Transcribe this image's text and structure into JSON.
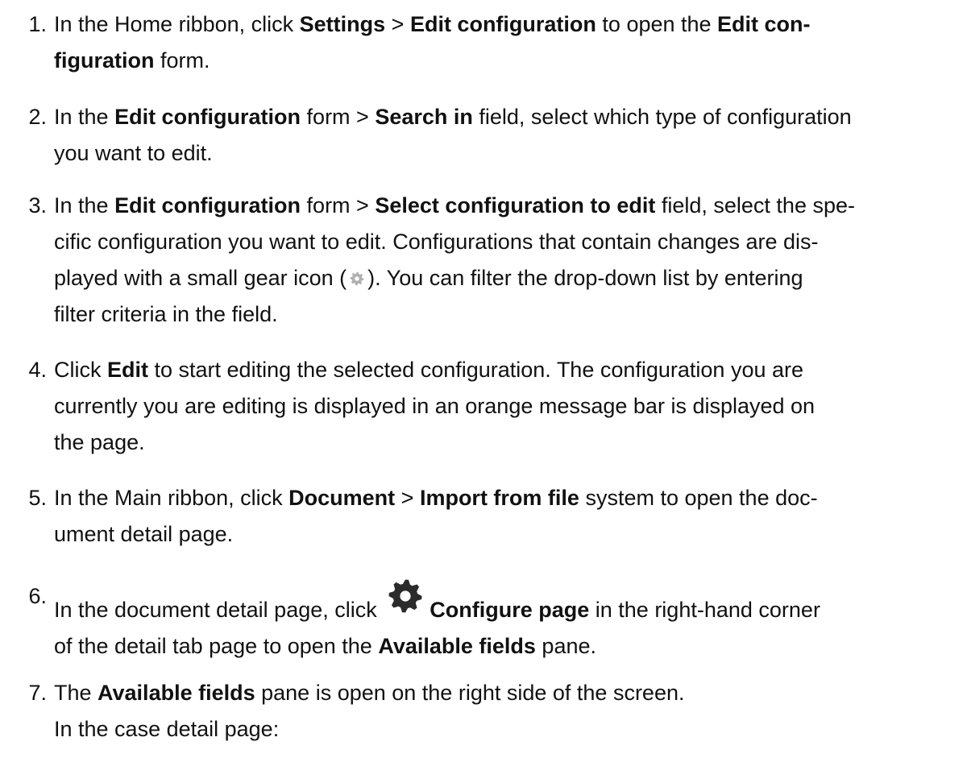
{
  "steps": [
    {
      "number": "1.",
      "lines": [
        [
          {
            "t": "In the Home ribbon, click "
          },
          {
            "t": "Settings",
            "b": true
          },
          {
            "t": " > "
          },
          {
            "t": "Edit configuration",
            "b": true
          },
          {
            "t": " to open the "
          },
          {
            "t": "Edit con-",
            "b": true
          }
        ],
        [
          {
            "t": "figuration",
            "b": true
          },
          {
            "t": " form."
          }
        ]
      ]
    },
    {
      "number": "2.",
      "lines": [
        [
          {
            "t": "In the "
          },
          {
            "t": "Edit configuration",
            "b": true
          },
          {
            "t": " form > "
          },
          {
            "t": "Search in",
            "b": true
          },
          {
            "t": " field, select which type of configuration"
          }
        ],
        [
          {
            "t": "you want to edit."
          }
        ]
      ]
    },
    {
      "number": "3.",
      "lines": [
        [
          {
            "t": "In the "
          },
          {
            "t": "Edit configuration",
            "b": true
          },
          {
            "t": " form > "
          },
          {
            "t": "Select configuration to edit",
            "b": true
          },
          {
            "t": " field, select the spe-"
          }
        ],
        [
          {
            "t": "cific configuration you want to edit. Configurations that contain changes are dis-"
          }
        ],
        [
          {
            "t": "played with a small gear icon ("
          },
          {
            "icon": "gear-small-icon"
          },
          {
            "t": "). You can filter the drop-down list by entering"
          }
        ],
        [
          {
            "t": "filter criteria in the field."
          }
        ]
      ]
    },
    {
      "number": "4.",
      "lines": [
        [
          {
            "t": "Click "
          },
          {
            "t": "Edit",
            "b": true
          },
          {
            "t": " to start editing the selected configuration. The configuration you are"
          }
        ],
        [
          {
            "t": "currently you are editing is displayed in an orange message bar is displayed on"
          }
        ],
        [
          {
            "t": "the page."
          }
        ]
      ]
    },
    {
      "number": "5.",
      "lines": [
        [
          {
            "t": "In the Main ribbon, click "
          },
          {
            "t": "Document",
            "b": true
          },
          {
            "t": " > "
          },
          {
            "t": "Import from file",
            "b": true
          },
          {
            "t": " system to open the doc-"
          }
        ],
        [
          {
            "t": "ument detail page."
          }
        ]
      ]
    },
    {
      "number": "6.",
      "lines": [
        [
          {
            "t": "In the document detail page, click "
          },
          {
            "icon": "gear-large-icon"
          },
          {
            "t": "Configure page",
            "b": true
          },
          {
            "t": " in the right-hand corner"
          }
        ],
        [
          {
            "t": "of the detail tab page to open the "
          },
          {
            "t": "Available fields",
            "b": true
          },
          {
            "t": " pane."
          }
        ]
      ]
    },
    {
      "number": "7.",
      "lines": [
        [
          {
            "t": "The "
          },
          {
            "t": "Available fields",
            "b": true
          },
          {
            "t": " pane is open on the right side of the screen."
          }
        ],
        [
          {
            "t": "In the case detail page:"
          }
        ]
      ]
    }
  ],
  "colors": {
    "text": "#111111",
    "background": "#ffffff",
    "gear_small": "#b0b0b0",
    "gear_large": "#2b2b2b"
  }
}
